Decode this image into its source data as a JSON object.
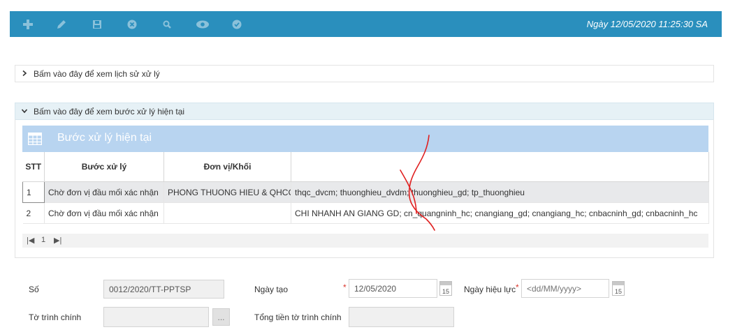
{
  "toolbar": {
    "buttons": [
      "add-icon",
      "edit-icon",
      "save-icon",
      "delete-icon",
      "search-icon",
      "view-icon",
      "approve-icon"
    ],
    "date_text": "Ngày 12/05/2020   11:25:30 SA",
    "bg_color": "#2a8fbd"
  },
  "history_panel": {
    "label": "Bấm vào đây để xem lịch sử xử lý"
  },
  "current_panel": {
    "label": "Bấm vào đây để xem bước xử lý hiện tại"
  },
  "grid": {
    "title": "Bước xử lý hiện tại",
    "columns": [
      "STT",
      "Bước xử lý",
      "Đơn vị/Khối",
      ""
    ],
    "rows": [
      {
        "stt": "1",
        "step": "Chờ đơn vị đầu mối xác nhận",
        "unit": "PHONG THUONG HIEU & QHCC",
        "users": "thqc_dvcm; thuonghieu_dvdm; thuonghieu_gd; tp_thuonghieu"
      },
      {
        "stt": "2",
        "step": "Chờ đơn vị đầu mối xác nhận",
        "unit": "",
        "users": "CHI NHANH AN GIANG GD; cn_quangninh_hc; cnangiang_gd; cnangiang_hc; cnbacninh_gd; cnbacninh_hc"
      }
    ],
    "pager": {
      "current_page": "1"
    }
  },
  "form": {
    "so": {
      "label": "Số",
      "value": "0012/2020/TT-PPTSP"
    },
    "ngay_tao": {
      "label": "Ngày tạo",
      "value": "12/05/2020",
      "required_mark": "*"
    },
    "ngay_hieu_luc": {
      "label": "Ngày hiệu lực",
      "placeholder": "<dd/MM/yyyy>",
      "required_mark": "*"
    },
    "to_trinh_chinh": {
      "label": "Tờ trình chính",
      "value": "",
      "button_label": "..."
    },
    "tong_tien": {
      "label": "Tổng tiền tờ trình chính",
      "value": ""
    },
    "calendar_day": "15"
  }
}
